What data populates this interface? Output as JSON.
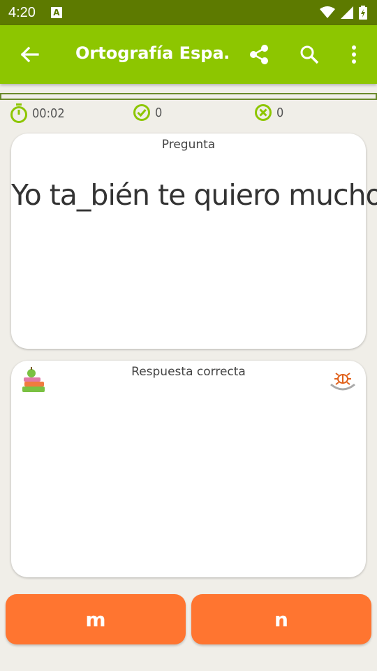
{
  "status_bar": {
    "time": "4:20",
    "icons": [
      "notification-a-icon",
      "wifi-icon",
      "signal-icon",
      "battery-icon"
    ],
    "notification_glyph": "A"
  },
  "toolbar": {
    "title": "Ortografía Espa…",
    "back_icon": "arrow-left-icon",
    "share_icon": "share-icon",
    "search_icon": "search-icon",
    "menu_icon": "more-vert-icon"
  },
  "stats": {
    "timer": "00:02",
    "correct": "0",
    "wrong": "0"
  },
  "question_card": {
    "title": "Pregunta",
    "text": "Yo ta_bién te quiero mucho."
  },
  "answer_card": {
    "title": "Respuesta correcta",
    "left_icon": "books-apple-icon",
    "right_icon": "bug-report-icon"
  },
  "answers": {
    "option_1": "m",
    "option_2": "n"
  },
  "colors": {
    "status_bar": "#5d7a00",
    "toolbar": "#8dc600",
    "accent_green": "#8dc600",
    "button": "#ff7530",
    "background": "#f0eee8"
  }
}
